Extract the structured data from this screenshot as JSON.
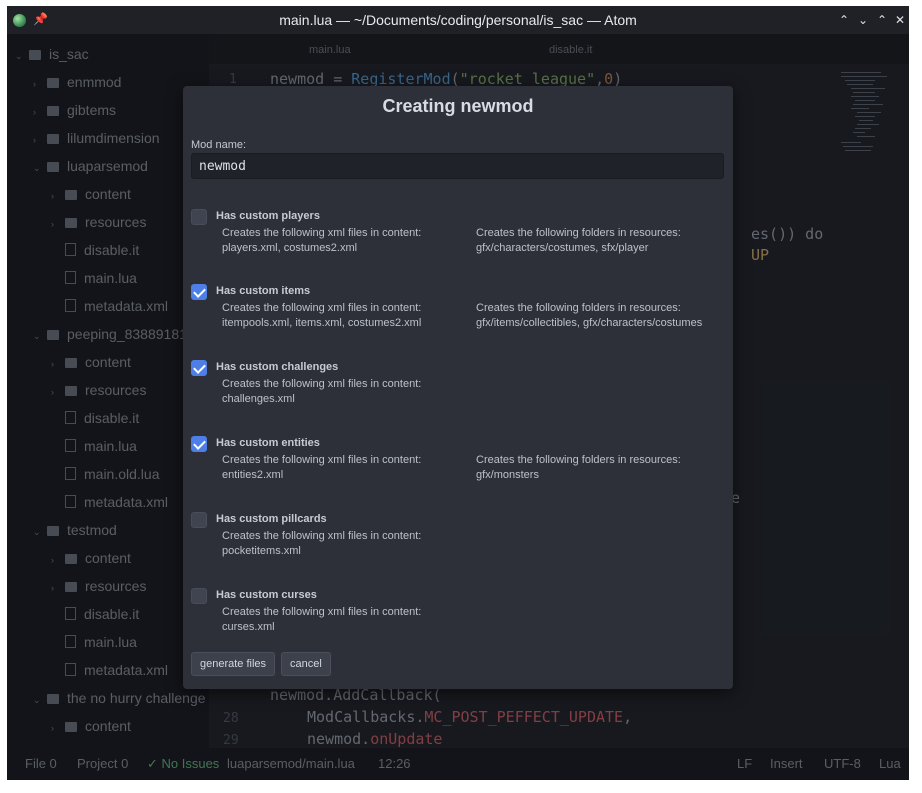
{
  "window": {
    "title": "main.lua — ~/Documents/coding/personal/is_sac — Atom"
  },
  "tree": {
    "items": [
      {
        "label": "is_sac",
        "kind": "folder",
        "depth": 0,
        "arrow": "v"
      },
      {
        "label": "enmmod",
        "kind": "folder",
        "depth": 1,
        "arrow": ">"
      },
      {
        "label": "gibtems",
        "kind": "folder",
        "depth": 1,
        "arrow": ">"
      },
      {
        "label": "lilumdimension",
        "kind": "folder",
        "depth": 1,
        "arrow": ">"
      },
      {
        "label": "luaparsemod",
        "kind": "folder",
        "depth": 1,
        "arrow": "v"
      },
      {
        "label": "content",
        "kind": "folder",
        "depth": 2,
        "arrow": ">"
      },
      {
        "label": "resources",
        "kind": "folder",
        "depth": 2,
        "arrow": ">"
      },
      {
        "label": "disable.it",
        "kind": "file",
        "depth": 2,
        "arrow": ""
      },
      {
        "label": "main.lua",
        "kind": "file",
        "depth": 2,
        "arrow": ""
      },
      {
        "label": "metadata.xml",
        "kind": "file",
        "depth": 2,
        "arrow": ""
      },
      {
        "label": "peeping_83889181",
        "kind": "folder",
        "depth": 1,
        "arrow": "v"
      },
      {
        "label": "content",
        "kind": "folder",
        "depth": 2,
        "arrow": ">"
      },
      {
        "label": "resources",
        "kind": "folder",
        "depth": 2,
        "arrow": ">"
      },
      {
        "label": "disable.it",
        "kind": "file",
        "depth": 2,
        "arrow": ""
      },
      {
        "label": "main.lua",
        "kind": "file",
        "depth": 2,
        "arrow": ""
      },
      {
        "label": "main.old.lua",
        "kind": "file",
        "depth": 2,
        "arrow": ""
      },
      {
        "label": "metadata.xml",
        "kind": "file",
        "depth": 2,
        "arrow": ""
      },
      {
        "label": "testmod",
        "kind": "folder",
        "depth": 1,
        "arrow": "v"
      },
      {
        "label": "content",
        "kind": "folder",
        "depth": 2,
        "arrow": ">"
      },
      {
        "label": "resources",
        "kind": "folder",
        "depth": 2,
        "arrow": ">"
      },
      {
        "label": "disable.it",
        "kind": "file",
        "depth": 2,
        "arrow": ""
      },
      {
        "label": "main.lua",
        "kind": "file",
        "depth": 2,
        "arrow": ""
      },
      {
        "label": "metadata.xml",
        "kind": "file",
        "depth": 2,
        "arrow": ""
      },
      {
        "label": "the no hurry challenge",
        "kind": "folder",
        "depth": 1,
        "arrow": "v"
      },
      {
        "label": "content",
        "kind": "folder",
        "depth": 2,
        "arrow": ">"
      }
    ]
  },
  "editor": {
    "tabs": [
      "main.lua",
      "disable.it"
    ],
    "line1": {
      "num": "1",
      "var": "newmod",
      "op": " = ",
      "fn": "RegisterMod",
      "open": "(",
      "str": "\"rocket league\"",
      "comma": ",",
      "num_arg": "0",
      "close": ")"
    },
    "frag_loop": "es()) do",
    "frag_up": "UP",
    "frag_e": "e",
    "line27": {
      "text": "newmod.AddCallback("
    },
    "line28": {
      "num": "28",
      "obj": "ModCallbacks.",
      "prop": "MC_POST_PEFFECT_UPDATE",
      "tail": ","
    },
    "line29": {
      "num": "29",
      "obj": "newmod.",
      "prop": "onUpdate"
    }
  },
  "statusbar": {
    "file": "File 0",
    "project": "Project 0",
    "issues": "✓ No Issues",
    "path": "luaparsemod/main.lua",
    "position": "12:26",
    "line_ending": "LF",
    "mode": "Insert",
    "encoding": "UTF-8",
    "grammar": "Lua"
  },
  "modal": {
    "title": "Creating newmod",
    "mod_name_label": "Mod name:",
    "mod_name_value": "newmod",
    "options": [
      {
        "label": "Has custom players",
        "checked": false,
        "content_heading": "Creates the following xml files in content:",
        "content_files": "players.xml, costumes2.xml",
        "resources_heading": "Creates the following folders in resources:",
        "resources_folders": "gfx/characters/costumes, sfx/player"
      },
      {
        "label": "Has custom items",
        "checked": true,
        "content_heading": "Creates the following xml files in content:",
        "content_files": "itempools.xml, items.xml, costumes2.xml",
        "resources_heading": "Creates the following folders in resources:",
        "resources_folders": "gfx/items/collectibles, gfx/characters/costumes"
      },
      {
        "label": "Has custom challenges",
        "checked": true,
        "content_heading": "Creates the following xml files in content:",
        "content_files": "challenges.xml",
        "resources_heading": "",
        "resources_folders": ""
      },
      {
        "label": "Has custom entities",
        "checked": true,
        "content_heading": "Creates the following xml files in content:",
        "content_files": "entities2.xml",
        "resources_heading": "Creates the following folders in resources:",
        "resources_folders": "gfx/monsters"
      },
      {
        "label": "Has custom pillcards",
        "checked": false,
        "content_heading": "Creates the following xml files in content:",
        "content_files": "pocketitems.xml",
        "resources_heading": "",
        "resources_folders": ""
      },
      {
        "label": "Has custom curses",
        "checked": false,
        "content_heading": "Creates the following xml files in content:",
        "content_files": "curses.xml",
        "resources_heading": "",
        "resources_folders": ""
      }
    ],
    "generate_label": "generate files",
    "cancel_label": "cancel"
  },
  "colors": {
    "accent_checkbox": "#4d7fe6",
    "modal_bg": "#2d3039",
    "window_bg": "#1b1d23"
  }
}
